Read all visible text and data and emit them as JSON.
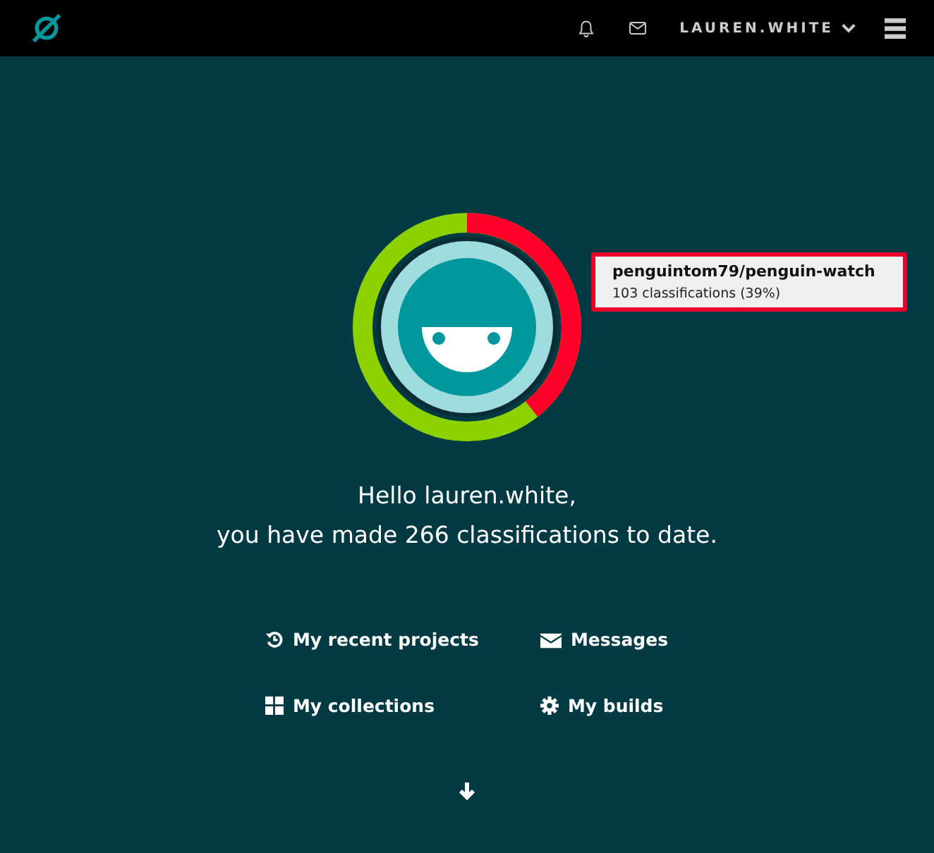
{
  "header": {
    "username": "LAUREN.WHITE"
  },
  "tooltip": {
    "title": "penguintom79/penguin-watch",
    "detail": "103 classifications (39%)"
  },
  "greeting": {
    "line_1": "Hello lauren.white,",
    "line_2": "you have made 266 classifications to date."
  },
  "links": [
    {
      "label": "My recent projects"
    },
    {
      "label": "Messages"
    },
    {
      "label": "My collections"
    },
    {
      "label": "My builds"
    }
  ]
}
